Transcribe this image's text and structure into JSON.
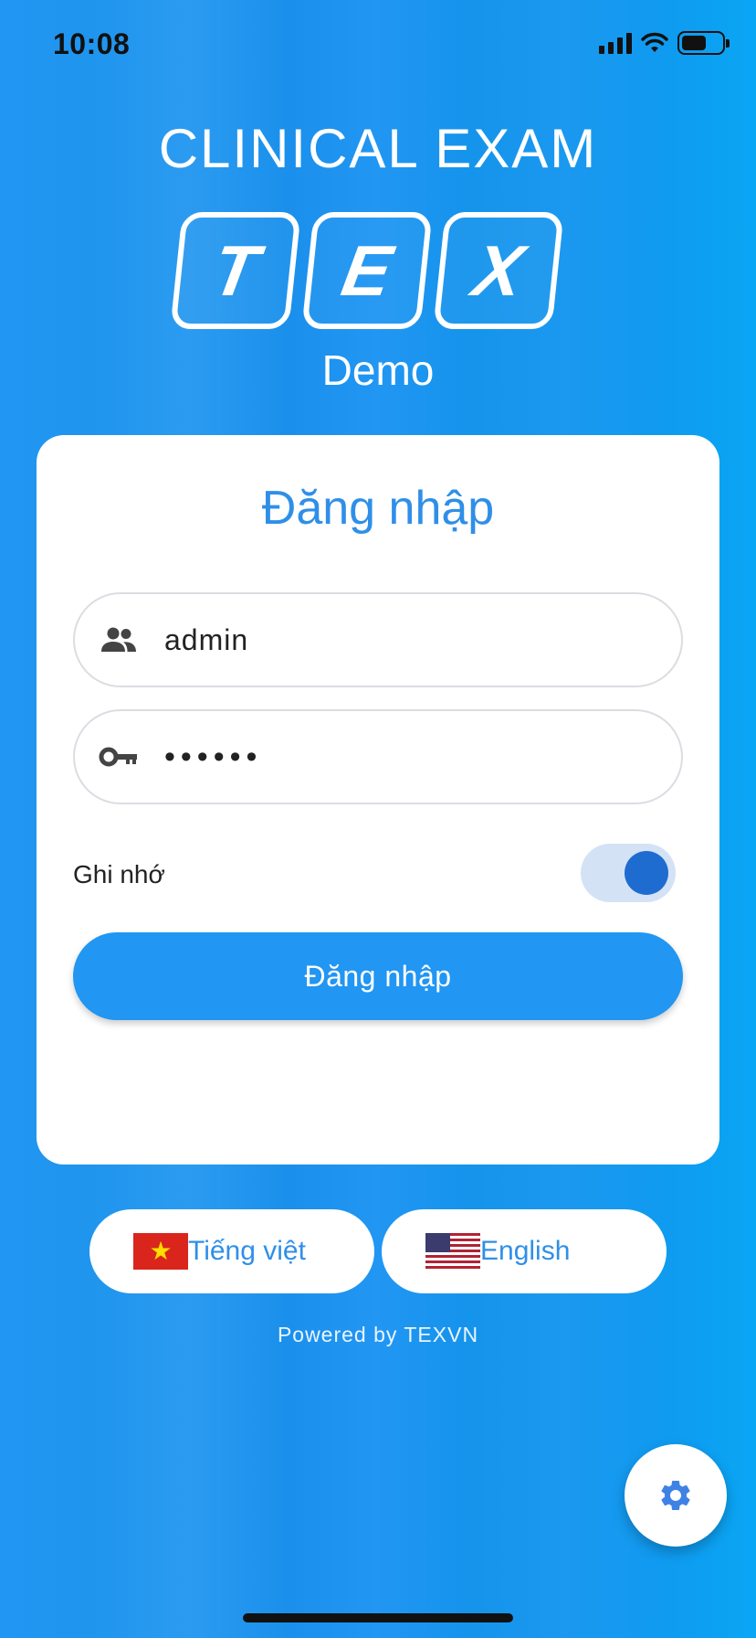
{
  "status_bar": {
    "time": "10:08"
  },
  "header": {
    "app_title": "CLINICAL EXAM",
    "logo_letters": [
      "T",
      "E",
      "X"
    ],
    "subtitle": "Demo"
  },
  "login_card": {
    "title": "Đăng nhập",
    "username": {
      "icon": "people-icon",
      "value": "admin"
    },
    "password": {
      "icon": "key-icon",
      "value": "••••••"
    },
    "remember": {
      "label": "Ghi nhớ",
      "enabled": true
    },
    "submit_label": "Đăng nhập"
  },
  "languages": [
    {
      "label": "Tiếng việt",
      "flag": "vietnam-flag-icon"
    },
    {
      "label": "English",
      "flag": "us-flag-icon"
    }
  ],
  "footer": {
    "powered_by": "Powered by TEXVN"
  },
  "colors": {
    "primary": "#2196f3",
    "accent_text": "#2f8fe8",
    "toggle_knob": "#1e6cd0",
    "toggle_track": "#d4e2f6"
  },
  "fab": {
    "icon": "gear-icon"
  }
}
